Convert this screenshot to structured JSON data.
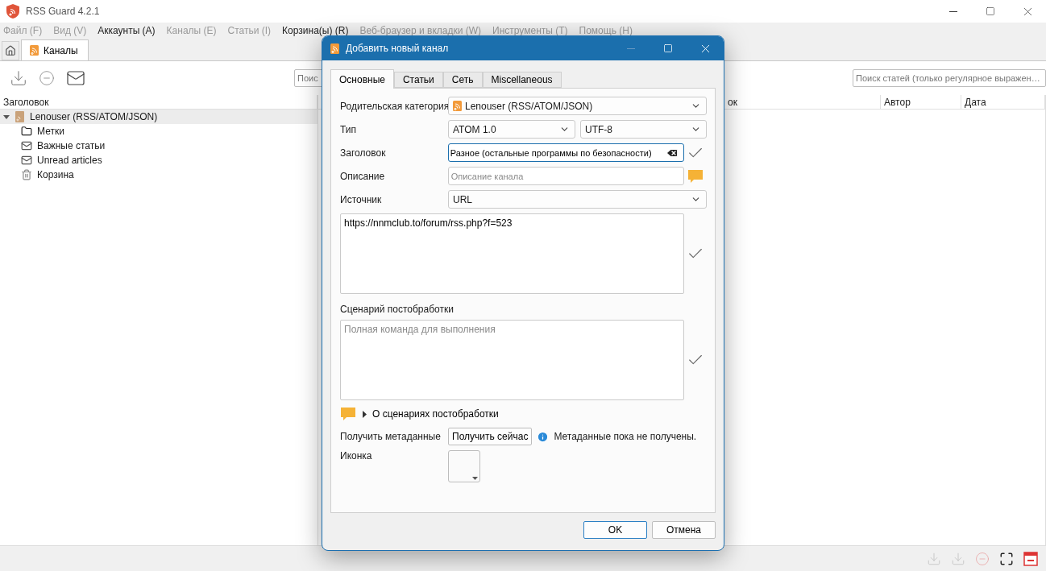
{
  "window": {
    "title": "RSS Guard 4.2.1"
  },
  "menu": [
    {
      "label": "Файл (F)",
      "disabled": true
    },
    {
      "label": "Вид (V)",
      "disabled": true
    },
    {
      "label": "Аккаунты (A)",
      "disabled": false
    },
    {
      "label": "Каналы (E)",
      "disabled": true
    },
    {
      "label": "Статьи (I)",
      "disabled": true
    },
    {
      "label": "Корзина(ы) (R)",
      "disabled": false
    },
    {
      "label": "Веб-браузер и вкладки (W)",
      "disabled": true
    },
    {
      "label": "Инструменты (T)",
      "disabled": true
    },
    {
      "label": "Помощь (H)",
      "disabled": true
    }
  ],
  "tabs": [
    {
      "label": "Каналы",
      "selected": true
    }
  ],
  "feed_search": {
    "placeholder": "Поис"
  },
  "article_search": {
    "placeholder": "Поиск статей (только регулярное выражен…"
  },
  "feeds": {
    "column": "Заголовок",
    "tree": [
      {
        "label": "Lenouser (RSS/ATOM/JSON)",
        "kind": "account",
        "expanded": true,
        "selected": true,
        "children": [
          {
            "label": "Метки",
            "kind": "labels",
            "selected": false
          },
          {
            "label": "Важные статьи",
            "kind": "important",
            "selected": false
          },
          {
            "label": "Unread articles",
            "kind": "unread",
            "selected": false
          },
          {
            "label": "Корзина",
            "kind": "bin",
            "selected": false
          }
        ]
      }
    ]
  },
  "articles": {
    "columns": [
      "ок",
      "Автор",
      "Дата"
    ]
  },
  "dialog": {
    "title": "Добавить новый канал",
    "tabs": [
      {
        "label": "Основные",
        "selected": true
      },
      {
        "label": "Статьи",
        "selected": false
      },
      {
        "label": "Сеть",
        "selected": false
      },
      {
        "label": "Miscellaneous",
        "selected": false
      }
    ],
    "rows": [
      {
        "kind": "combo",
        "label": "Родительская категория",
        "value": "Lenouser (RSS/ATOM/JSON)"
      },
      {
        "kind": "combo_pair",
        "label": "Тип",
        "value": "ATOM 1.0",
        "value_2": "UTF-8"
      },
      {
        "kind": "text",
        "label": "Заголовок",
        "value": "Разное (остальные программы по безопасности)",
        "valid": true
      },
      {
        "kind": "text",
        "label": "Описание",
        "placeholder": "Описание канала"
      },
      {
        "kind": "combo",
        "label": "Источник",
        "value": "URL"
      },
      {
        "kind": "textarea",
        "value": "https://nnmclub.to/forum/rss.php?f=523",
        "valid": true
      },
      {
        "kind": "section_label",
        "label": "Сценарий постобработки"
      },
      {
        "kind": "textarea",
        "placeholder": "Полная команда для выполнения",
        "valid": true
      },
      {
        "kind": "expander",
        "label": "О сценариях постобработки",
        "expanded": false
      },
      {
        "kind": "metadata",
        "label": "Получить метаданные",
        "button": "Получить сейчас",
        "status": "Метаданные пока не получены."
      },
      {
        "kind": "icon_picker",
        "label": "Иконка"
      }
    ],
    "buttons": [
      {
        "label": "OK",
        "default": true
      },
      {
        "label": "Отмена",
        "default": false
      }
    ]
  }
}
